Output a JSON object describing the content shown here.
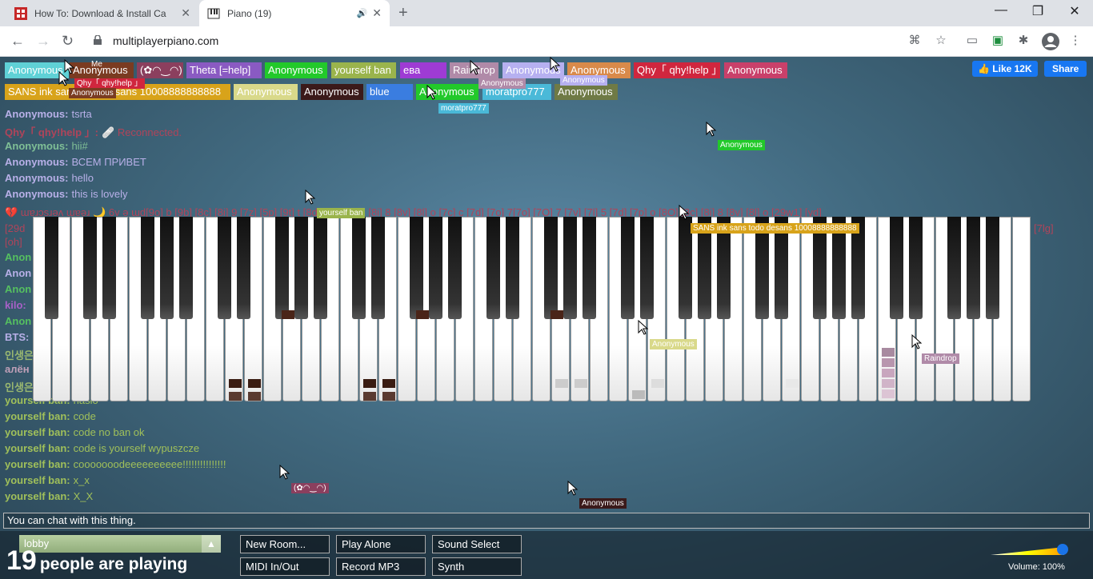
{
  "browser": {
    "tabs": [
      {
        "title": "How To: Download & Install Ca",
        "active": false
      },
      {
        "title": "Piano (19)",
        "active": true
      }
    ],
    "url": "multiplayerpiano.com"
  },
  "users_row1": [
    {
      "name": "Anonymous",
      "color": "#5fd1d6"
    },
    {
      "name": "Anonymous",
      "color": "#7a3b21"
    },
    {
      "name": "(✿◠‿◠)",
      "color": "#8b3f5e"
    },
    {
      "name": "Theta [=help]",
      "color": "#8a5ac2"
    },
    {
      "name": "Anonymous",
      "color": "#22c92a"
    },
    {
      "name": "yourself ban",
      "color": "#9ab44c"
    },
    {
      "name": "ева",
      "color": "#9e3bd4"
    },
    {
      "name": "Raindrop",
      "color": "#b08aa8"
    },
    {
      "name": "Anonymous",
      "color": "#b6b0f0"
    },
    {
      "name": "Anonymous",
      "color": "#d98a4a"
    },
    {
      "name": "Qhy「 qhy!help 」",
      "color": "#d0263e"
    },
    {
      "name": "Anonymous",
      "color": "#c9406a"
    }
  ],
  "users_row2": [
    {
      "name": "SANS ink sans todo desans 10008888888888",
      "color": "#d8a31a"
    },
    {
      "name": "Anonymous",
      "color": "#d9d98a"
    },
    {
      "name": "Anonymous",
      "color": "#3b1a1a"
    },
    {
      "name": "blue",
      "color": "#3a7de0"
    },
    {
      "name": "Anonymous",
      "color": "#22c92a"
    },
    {
      "name": "moratpro777",
      "color": "#4ab9d8"
    },
    {
      "name": "Anonymous",
      "color": "#6f7a45"
    }
  ],
  "me_label": "Me",
  "overlay_labels": {
    "qhy": "Qhy「 qhy!help 」",
    "anon_under_me": "Anonymous",
    "anon_under_raindrop": "Anonymous",
    "anon_under_anon": "Anonymous",
    "moratpro": "moratpro777",
    "anon_green": "Anonymous",
    "yourself_ban": "yourself ban",
    "sans": "SANS ink sans todo desans 10008888888888",
    "anon_yellow": "Anonymous",
    "raindrop": "Raindrop",
    "smile": "(✿◠‿◠)",
    "anon_dark": "Anonymous"
  },
  "facebook": {
    "like": "Like 12K",
    "share": "Share"
  },
  "chat": [
    {
      "name": "Anonymous:",
      "msg": "tsrta",
      "color": "#b8b0e8"
    },
    {
      "name": "Qhy「 qhy!help 」:",
      "msg": "🩹 Reconnected.",
      "color": "#b0445a"
    },
    {
      "name": "Anonymous:",
      "msg": "hii#",
      "color": "#7fbf96"
    },
    {
      "name": "Anonymous:",
      "msg": "ВСЕМ ПРИВЕТ",
      "color": "#b8b0e8"
    },
    {
      "name": "Anonymous:",
      "msg": "hello",
      "color": "#b8b0e8"
    },
    {
      "name": "Anonymous:",
      "msg": "this is lovely",
      "color": "#b8b0e8"
    }
  ],
  "chat_partial": [
    {
      "name": "Anon",
      "color": "#55c060"
    },
    {
      "name": "Anon",
      "color": "#b8b0e8"
    },
    {
      "name": "Anon",
      "color": "#55c060"
    },
    {
      "name": "kilo:",
      "color": "#a860c8"
    },
    {
      "name": "Anon",
      "color": "#55c060"
    },
    {
      "name": "BTS:",
      "color": "#b8b0e8"
    },
    {
      "name": "인생은",
      "color": "#9ab870"
    },
    {
      "name": "алён",
      "color": "#c0a0b8"
    },
    {
      "name": "인생은",
      "color": "#9ab870"
    }
  ],
  "chat_bottom": [
    {
      "name": "yourself ban:",
      "msg": "hasło",
      "color": "#a0c05a"
    },
    {
      "name": "yourself ban:",
      "msg": "code",
      "color": "#a0c05a"
    },
    {
      "name": "yourself ban:",
      "msg": "code no ban ok",
      "color": "#a0c05a"
    },
    {
      "name": "yourself ban:",
      "msg": "code is yourself wypuszcze",
      "color": "#a0c05a"
    },
    {
      "name": "yourself ban:",
      "msg": "cooooooodeeeeeeeeee!!!!!!!!!!!!!!!",
      "color": "#a0c05a"
    },
    {
      "name": "yourself ban:",
      "msg": "x_x",
      "color": "#a0c05a"
    },
    {
      "name": "yourself ban:",
      "msg": "X_X",
      "color": "#a0c05a"
    }
  ],
  "spam_line": "💔 ɯɐɹɔsɹǝʌ ɯɐǝɹ 🌙  6v ǝ ɯd[9o] b [9b] [8c] [8i] 9 [7z] [5p] [9t] t [8d8 [8O] [8c] [8i] 8 [8v] [8l] o [7c] c [7d] [7o] 7[7o] [7O] 7 [7v] [7l] 5 [7d] [7p] o [8O] [8c] [8i] 8 [8v] [8l] o [29w1] [yd]",
  "spam_line2a": "[29d",
  "spam_line2b": "[7lg]",
  "spam_line3": "[oh]",
  "chat_placeholder": "You can chat with this thing.",
  "room": {
    "name": "lobby"
  },
  "people_count": "19",
  "people_text": "people are playing",
  "buttons": {
    "new_room": "New Room...",
    "play_alone": "Play Alone",
    "sound_select": "Sound Select",
    "midi": "MIDI In/Out",
    "record": "Record MP3",
    "synth": "Synth"
  },
  "volume_label": "Volume: 100%",
  "volume_level": 1.0
}
